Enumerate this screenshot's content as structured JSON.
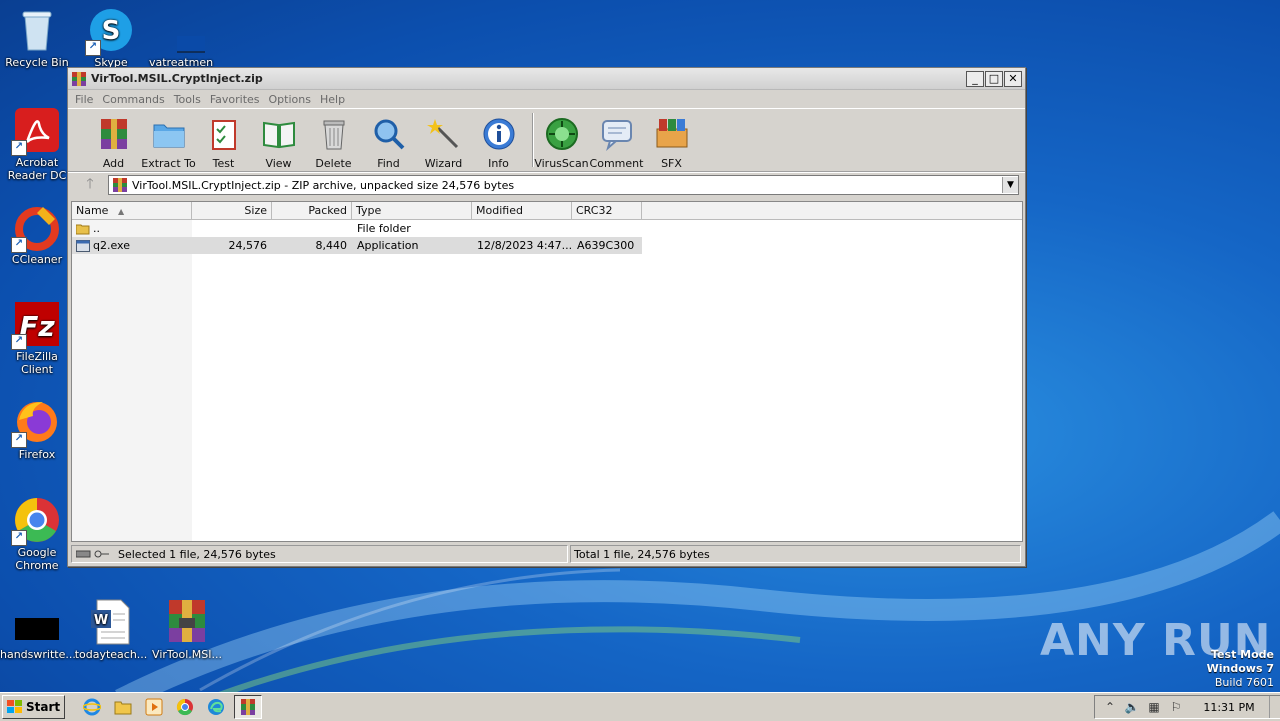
{
  "desktop": {
    "icons": [
      {
        "label": "Recycle Bin"
      },
      {
        "label": "Skype"
      },
      {
        "label": "vatreatmen"
      },
      {
        "label": "Acrobat Reader DC"
      },
      {
        "label": "CCleaner"
      },
      {
        "label": "FileZilla Client"
      },
      {
        "label": "Firefox"
      },
      {
        "label": "Google Chrome"
      },
      {
        "label": "handswritte..."
      },
      {
        "label": "todayteach..."
      },
      {
        "label": "VirTool.MSI..."
      }
    ]
  },
  "window": {
    "title": "VirTool.MSIL.CryptInject.zip",
    "menu": [
      "File",
      "Commands",
      "Tools",
      "Favorites",
      "Options",
      "Help"
    ],
    "toolbar": [
      "Add",
      "Extract To",
      "Test",
      "View",
      "Delete",
      "Find",
      "Wizard",
      "Info",
      "VirusScan",
      "Comment",
      "SFX"
    ],
    "address": "VirTool.MSIL.CryptInject.zip - ZIP archive, unpacked size 24,576 bytes",
    "columns": [
      "Name",
      "Size",
      "Packed",
      "Type",
      "Modified",
      "CRC32"
    ],
    "rows": [
      {
        "name": "..",
        "size": "",
        "packed": "",
        "type": "File folder",
        "modified": "",
        "crc": ""
      },
      {
        "name": "q2.exe",
        "size": "24,576",
        "packed": "8,440",
        "type": "Application",
        "modified": "12/8/2023 4:47...",
        "crc": "A639C300"
      }
    ],
    "status_left": "Selected 1 file, 24,576 bytes",
    "status_right": "Total 1 file, 24,576 bytes"
  },
  "taskbar": {
    "start_label": "Start",
    "clock": "11:31 PM"
  },
  "watermark": "ANY RUN",
  "testmode": {
    "line1": "Test Mode",
    "line2": "Windows 7",
    "line3": "Build 7601"
  },
  "colors": {
    "desktop": "#1566c6",
    "window_bg": "#d6d3ce",
    "selection": "#dcdcdc"
  }
}
